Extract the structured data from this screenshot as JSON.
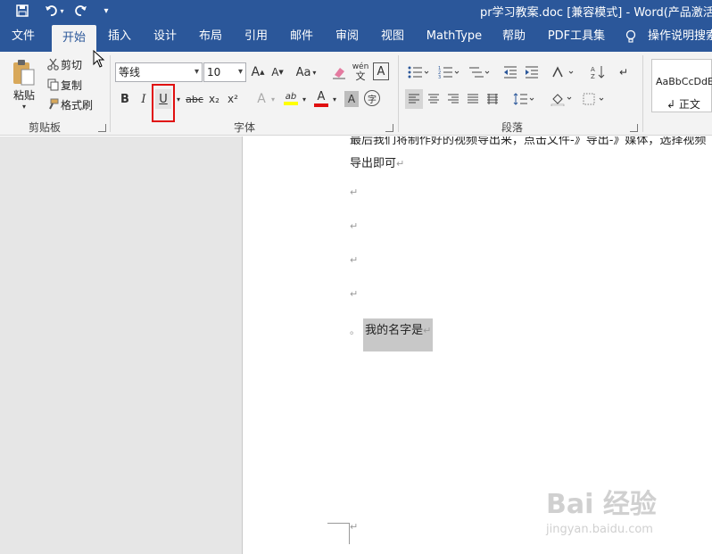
{
  "window": {
    "title": "pr学习教案.doc [兼容模式] - Word(产品激活失"
  },
  "tabs": [
    {
      "label": "文件",
      "active": false
    },
    {
      "label": "开始",
      "active": true
    },
    {
      "label": "插入",
      "active": false
    },
    {
      "label": "设计",
      "active": false
    },
    {
      "label": "布局",
      "active": false
    },
    {
      "label": "引用",
      "active": false
    },
    {
      "label": "邮件",
      "active": false
    },
    {
      "label": "审阅",
      "active": false
    },
    {
      "label": "视图",
      "active": false
    },
    {
      "label": "MathType",
      "active": false
    },
    {
      "label": "帮助",
      "active": false
    },
    {
      "label": "PDF工具集",
      "active": false
    }
  ],
  "tell_me": {
    "label": "操作说明搜索"
  },
  "clipboard": {
    "paste_label": "粘贴",
    "cut_label": "剪切",
    "copy_label": "复制",
    "format_painter_label": "格式刷",
    "group_label": "剪贴板"
  },
  "font": {
    "font_name": "等线",
    "font_size": "10",
    "grow_label": "A",
    "shrink_label": "A",
    "case_label": "Aa",
    "phonetic_label": "wén",
    "bold_label": "B",
    "italic_label": "I",
    "underline_label": "U",
    "strike_label": "abc",
    "subscript_label": "x₂",
    "superscript_label": "x²",
    "text_effect_label": "A",
    "highlight_label": "ab",
    "font_color_label": "A",
    "char_shading_label": "A",
    "enclose_label": "字",
    "group_label": "字体"
  },
  "paragraph": {
    "group_label": "段落"
  },
  "styles": {
    "sample_text": "AaBbCcDdE",
    "normal_label": "正文"
  },
  "document": {
    "line1": "最后我们将制作好的视频导出来，点击文件-》导出-》媒体，选择视频",
    "line2": "导出即可",
    "para_mark": "↵",
    "selected_text": "我的名字是",
    "bullet": "。"
  },
  "watermark": {
    "brand": "Bai 经验",
    "url": "jingyan.baidu.com"
  },
  "colors": {
    "ribbon_blue": "#2b579a",
    "ribbon_bg": "#f3f3f3",
    "selection_gray": "#c8c8c8",
    "highlight_red": "#e01010",
    "highlight_yellow": "#ffff00",
    "font_color_red": "#e01010"
  }
}
